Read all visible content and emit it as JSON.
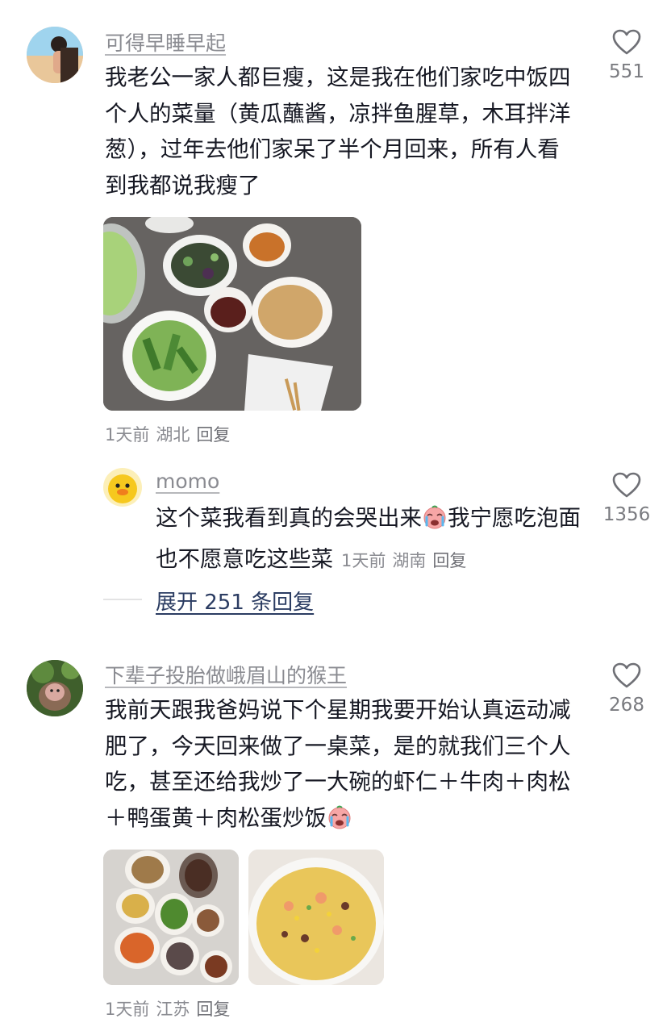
{
  "comments": [
    {
      "username": "可得早睡早起",
      "text": "我老公一家人都巨瘦，这是我在他们家吃中饭四个人的菜量（黄瓜蘸酱，凉拌鱼腥草，木耳拌洋葱），过年去他们家呆了半个月回来，所有人看到我都说我瘦了",
      "likes": "551",
      "time": "1天前",
      "location": "湖北",
      "reply_label": "回复"
    },
    {
      "username": "下辈子投胎做峨眉山的猴王",
      "text": "我前天跟我爸妈说下个星期我要开始认真运动减肥了，今天回来做了一桌菜，是的就我们三个人吃，甚至还给我炒了一大碗的虾仁＋牛肉＋肉松＋鸭蛋黄＋肉松蛋炒饭",
      "likes": "268",
      "time": "1天前",
      "location": "江苏",
      "reply_label": "回复"
    }
  ],
  "reply": {
    "username": "momo",
    "text_before_emoji": "这个菜我看到真的会哭出来",
    "text_after_emoji": "我宁愿吃泡面也不愿意吃这些菜",
    "likes": "1356",
    "time": "1天前",
    "location": "湖南",
    "reply_label": "回复"
  },
  "expand_label": "展开 251 条回复",
  "icons": {
    "like": "heart-outline-icon",
    "emoji": "crying-face-emoji"
  },
  "colors": {
    "text": "#161823",
    "secondary": "#8a8b91",
    "link": "#2b3c62"
  }
}
